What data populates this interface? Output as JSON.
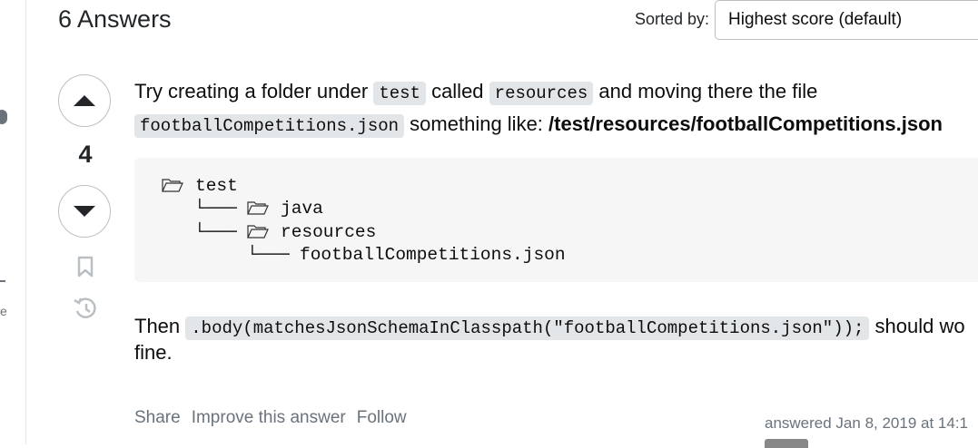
{
  "header": {
    "answers_count": "6 Answers",
    "sort_label": "Sorted by:",
    "sort_value": "Highest score (default)"
  },
  "vote": {
    "score": "4"
  },
  "answer": {
    "p1_a": "Try creating a folder under",
    "p1_code1": "test",
    "p1_b": "called",
    "p1_code2": "resources",
    "p1_c": "and moving there the file",
    "p1_code3": "footballCompetitions.json",
    "p1_d": "something like:",
    "p1_path": "/test/resources/footballCompetitions.json",
    "tree": {
      "root": "test",
      "branch1_prefix": "└───",
      "branch1": "java",
      "branch2_prefix": "└───",
      "branch2": "resources",
      "leaf_prefix": "└───",
      "leaf": "footballCompetitions.json"
    },
    "p2_a": "Then",
    "p2_code": ".body(matchesJsonSchemaInClasspath(\"footballCompetitions.json\"));",
    "p2_b": "should wo",
    "p2_c": "fine."
  },
  "menu": {
    "share": "Share",
    "improve": "Improve this answer",
    "follow": "Follow"
  },
  "meta": {
    "answered": "answered Jan 8, 2019 at 14:1"
  },
  "sidebar": {
    "fragment": "e"
  },
  "icons": {
    "upvote": "arrow-up-icon",
    "downvote": "arrow-down-icon",
    "bookmark": "bookmark-icon",
    "history": "history-icon",
    "folder": "folder-icon"
  }
}
